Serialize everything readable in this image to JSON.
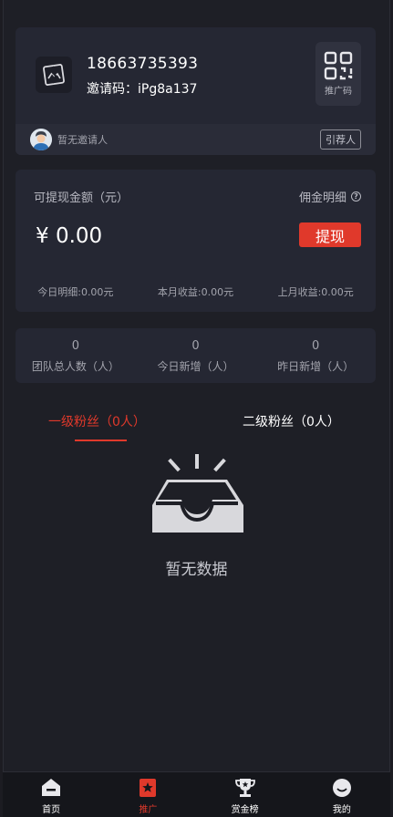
{
  "profile": {
    "phone": "18663735393",
    "invite_code": "邀请码：iPg8a137",
    "qr_label": "推广码",
    "referrer_text": "暂无邀请人",
    "referrer_button": "引荐人"
  },
  "balance": {
    "label": "可提现金额（元）",
    "detail_link": "佣金明细",
    "amount": "¥ 0.00",
    "withdraw_button": "提现",
    "stats": [
      "今日明细:0.00元",
      "本月收益:0.00元",
      "上月收益:0.00元"
    ]
  },
  "team": [
    {
      "value": "0",
      "label": "团队总人数（人）"
    },
    {
      "value": "0",
      "label": "今日新增（人）"
    },
    {
      "value": "0",
      "label": "昨日新增（人）"
    }
  ],
  "tabs": {
    "active": "一级粉丝（0人）",
    "inactive": "二级粉丝（0人）"
  },
  "empty_text": "暂无数据",
  "tabbar": [
    {
      "label": "首页",
      "icon": "home-icon"
    },
    {
      "label": "推广",
      "icon": "promote-icon"
    },
    {
      "label": "赏金榜",
      "icon": "trophy-icon"
    },
    {
      "label": "我的",
      "icon": "profile-icon"
    }
  ],
  "colors": {
    "accent": "#e0392b",
    "card": "#252733",
    "background": "#1e1f26"
  }
}
